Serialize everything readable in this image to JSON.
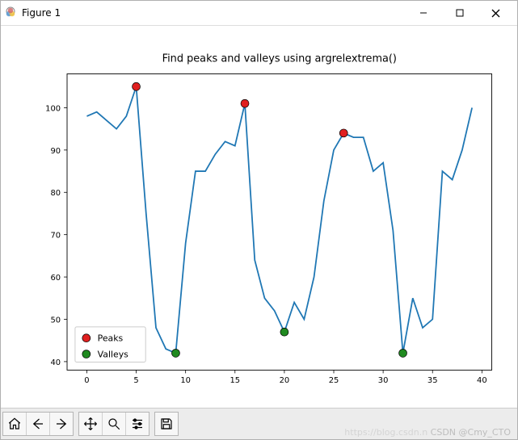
{
  "window": {
    "title": "Figure 1"
  },
  "watermark": {
    "faded": "https://blog.csdn.n",
    "text": "CSDN @Cmy_CTO"
  },
  "chart_data": {
    "type": "line",
    "title": "Find peaks and valleys using argrelextrema()",
    "xlabel": "",
    "ylabel": "",
    "xlim": [
      -2,
      41
    ],
    "ylim": [
      38,
      108
    ],
    "xticks": [
      0,
      5,
      10,
      15,
      20,
      25,
      30,
      35,
      40
    ],
    "yticks": [
      40,
      50,
      60,
      70,
      80,
      90,
      100
    ],
    "series": [
      {
        "name": "line",
        "x": [
          0,
          1,
          2,
          3,
          4,
          5,
          6,
          7,
          8,
          9,
          10,
          11,
          12,
          13,
          14,
          15,
          16,
          17,
          18,
          19,
          20,
          21,
          22,
          23,
          24,
          25,
          26,
          27,
          28,
          29,
          30,
          31,
          32,
          33,
          34,
          35,
          36,
          37,
          38,
          39
        ],
        "y": [
          98,
          99,
          97,
          95,
          98,
          105,
          75,
          48,
          43,
          42,
          68,
          85,
          85,
          89,
          92,
          91,
          101,
          64,
          55,
          52,
          47,
          54,
          50,
          60,
          78,
          90,
          94,
          93,
          93,
          85,
          87,
          71,
          42,
          55,
          48,
          50,
          85,
          83,
          90,
          100
        ]
      }
    ],
    "markers": {
      "peaks": {
        "color": "#e02020",
        "xy": [
          [
            5,
            105
          ],
          [
            16,
            101
          ],
          [
            26,
            94
          ]
        ]
      },
      "valleys": {
        "color": "#208a20",
        "xy": [
          [
            9,
            42
          ],
          [
            20,
            47
          ],
          [
            32,
            42
          ]
        ]
      }
    },
    "legend": [
      {
        "label": "Peaks",
        "color": "#e02020"
      },
      {
        "label": "Valleys",
        "color": "#208a20"
      }
    ],
    "line_color": "#1f77b4"
  }
}
